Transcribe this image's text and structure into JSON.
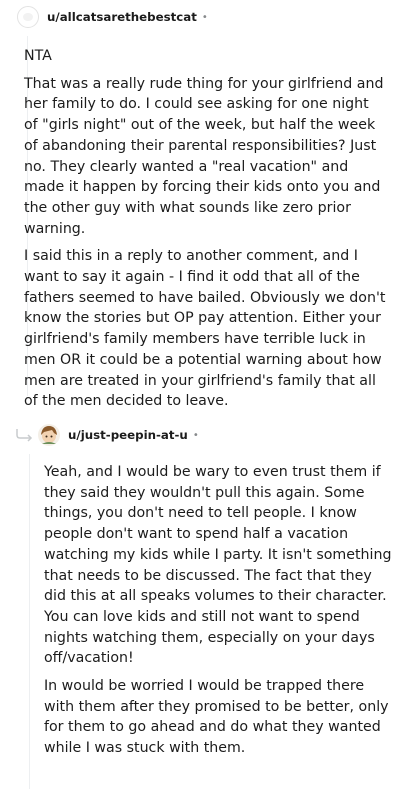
{
  "comment1": {
    "username": "u/allcatsarethebestcat",
    "dot": "•",
    "paragraphs": [
      "NTA",
      "That was a really rude thing for your girlfriend and her family to do. I could see asking for one night of \"girls night\" out of the week, but half the week of abandoning their parental responsibilities? Just no. They clearly wanted a \"real vacation\" and made it happen by forcing their kids onto you and the other guy with what sounds like zero prior warning.",
      "I said this in a reply to another comment, and I want to say it again - I find it odd that all of the fathers seemed to have bailed. Obviously we don't know the stories but OP pay attention. Either your girlfriend's family members have terrible luck in men OR it could be a potential warning about how men are treated in your girlfriend's family that all of the men decided to leave."
    ]
  },
  "comment2": {
    "username": "u/just-peepin-at-u",
    "dot": "•",
    "paragraphs": [
      "Yeah, and I would be wary to even trust them if they said they wouldn't pull this again. Some things, you don't need to tell people. I know people don't want to spend half a vacation watching my kids while I party. It isn't something that needs to be discussed. The fact that they did this at all speaks volumes to their character. You can love kids and still not want to spend nights watching them, especially on your days off/vacation!",
      "In would be worried I would be trapped there with them after they promised to be better, only for them to go ahead and do what they wanted while I was stuck with them."
    ]
  }
}
